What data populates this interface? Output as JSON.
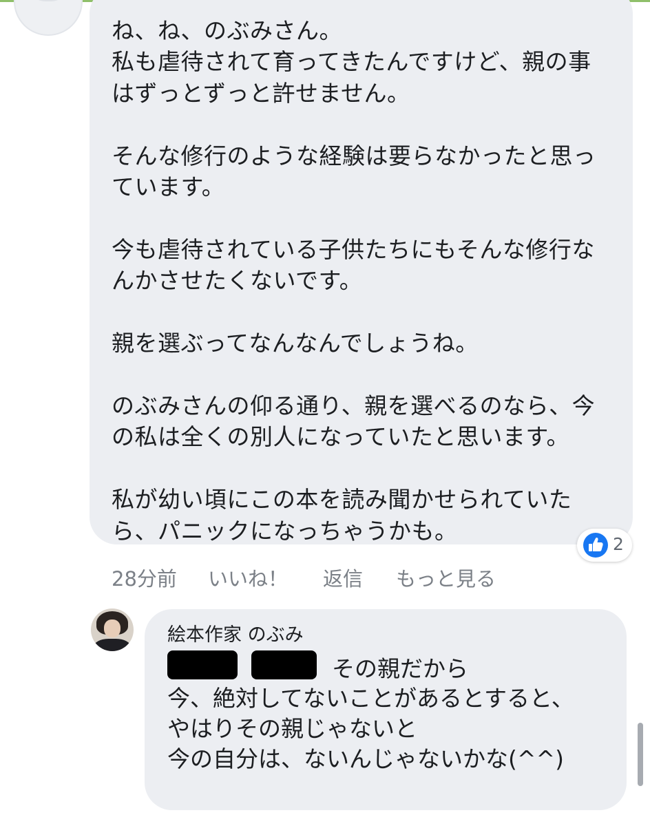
{
  "comment_1": {
    "text": "ね、ね、のぶみさん。\n私も虐待されて育ってきたんですけど、親の事はずっとずっと許せません。\n\nそんな修行のような経験は要らなかったと思っています。\n\n今も虐待されている子供たちにもそんな修行なんかさせたくないです。\n\n親を選ぶってなんなんでしょうね。\n\nのぶみさんの仰る通り、親を選べるのなら、今の私は全くの別人になっていたと思います。\n\n私が幼い頃にこの本を読み聞かせられていたら、パニックになっちゃうかも。",
    "reactions": {
      "icon": "like-icon",
      "count": "2",
      "color": "#1877f2"
    },
    "actions": {
      "time": "28分前",
      "like": "いいね！",
      "reply": "返信",
      "more": "もっと見る"
    }
  },
  "reply": {
    "author": "絵本作家 のぶみ",
    "first_line_after_redaction": "その親だから",
    "text": "今、絶対してないことがあるとすると、\nやはりその親じゃないと\n今の自分は、ないんじゃないかな(^^)"
  },
  "colors": {
    "bubble": "#eceef2",
    "text": "#1c1e21",
    "meta": "#7b8087",
    "accent_top": "#8fbf6a"
  }
}
